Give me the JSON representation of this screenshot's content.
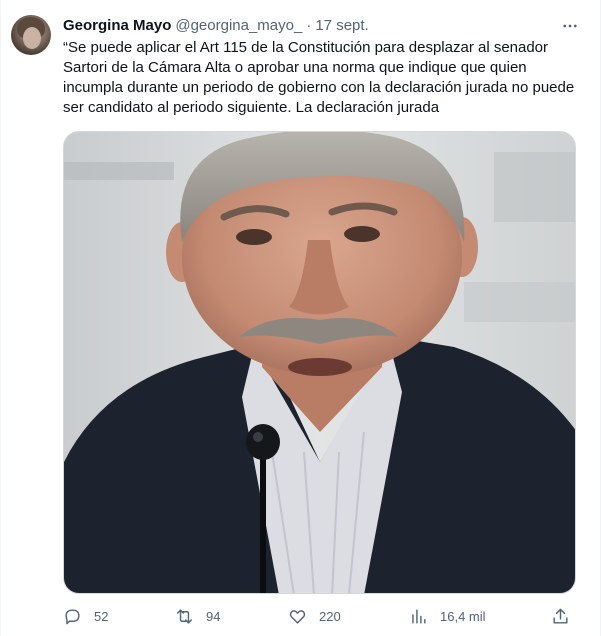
{
  "tweet": {
    "author_name": "Georgina Mayo",
    "author_handle": "@georgina_mayo_",
    "separator": "·",
    "date": "17 sept.",
    "text": "“Se puede aplicar el Art 115 de la Constitución para desplazar al senador Sartori de la Cámara Alta o aprobar una norma que indique que quien incumpla durante un periodo de gobierno con la declaración jurada no puede ser candidato al periodo siguiente. La declaración jurada",
    "media_alt": "Foto de un hombre de cabello canoso y bigote hablando frente a un micrófono"
  },
  "actions": {
    "replies": "52",
    "retweets": "94",
    "likes": "220",
    "views": "16,4 mil"
  },
  "icons": {
    "more": "more-dots-icon",
    "reply": "reply-icon",
    "retweet": "retweet-icon",
    "like": "heart-icon",
    "views": "views-chart-icon",
    "share": "share-icon"
  },
  "colors": {
    "text": "#0f1419",
    "secondary": "#536471",
    "border": "#cfd9de"
  }
}
